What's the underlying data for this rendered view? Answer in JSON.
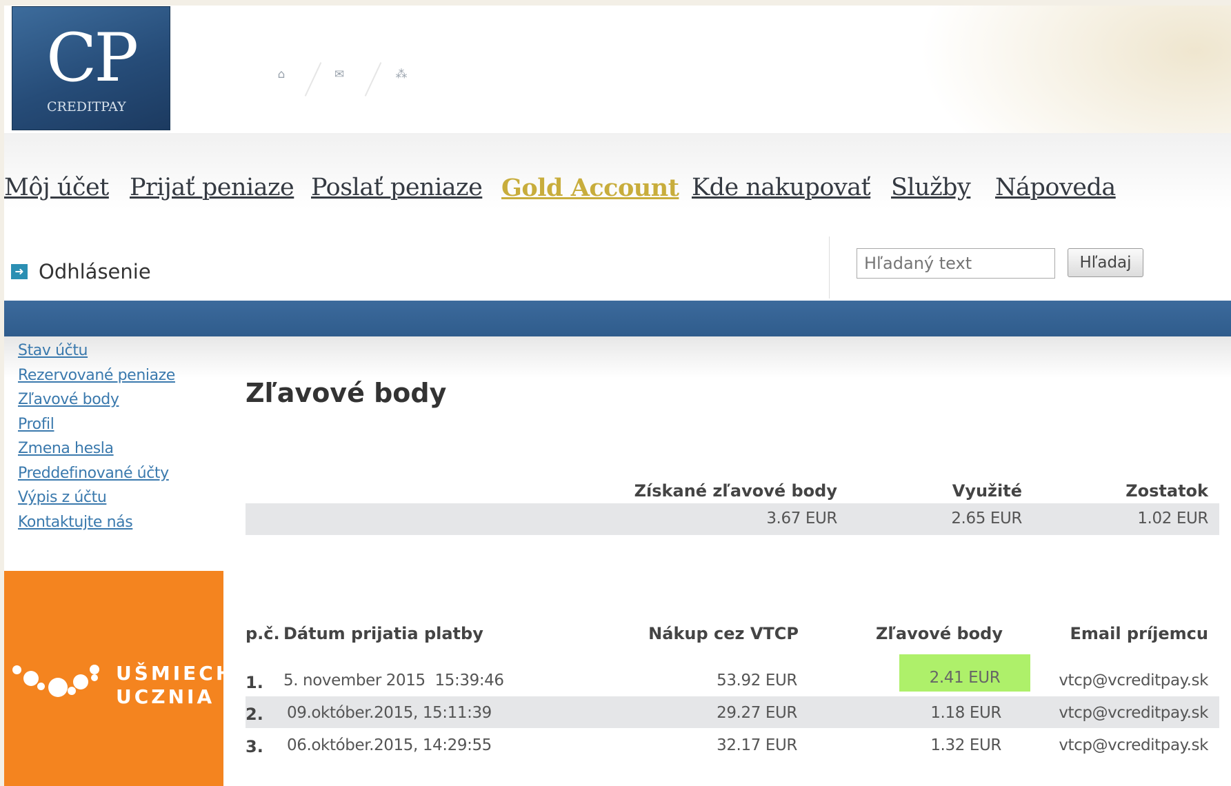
{
  "logo": {
    "monogram": "CP",
    "name": "CREDITPAY"
  },
  "top_icons": [
    "home-icon",
    "mail-icon",
    "sitemap-icon"
  ],
  "main_nav": [
    {
      "label": "Môj účet"
    },
    {
      "label": "Prijať peniaze"
    },
    {
      "label": "Poslať peniaze"
    },
    {
      "label": "Gold Account",
      "highlight": true
    },
    {
      "label": "Kde nakupovať"
    },
    {
      "label": "Služby"
    },
    {
      "label": "Nápoveda"
    }
  ],
  "logout_label": "Odhlásenie",
  "search": {
    "placeholder": "Hľadaný text",
    "button": "Hľadaj"
  },
  "side_nav": [
    "Stav účtu",
    "Rezervované peniaze",
    "Zľavové body",
    "Profil",
    "Zmena hesla",
    "Preddefinované účty",
    "Výpis z účtu",
    "Kontaktujte nás"
  ],
  "banner": {
    "line1": "UŠMIECH",
    "line2": "UCZNIA"
  },
  "page_title": "Zľavové body",
  "summary": {
    "headers": [
      "Získané zľavové body",
      "Využité",
      "Zostatok"
    ],
    "values": [
      "3.67 EUR",
      "2.65 EUR",
      "1.02 EUR"
    ]
  },
  "transactions": {
    "headers": {
      "no": "p.č.",
      "date": "Dátum prijatia platby",
      "purchase": "Nákup cez VTCP",
      "points": "Zľavové body",
      "email": "Email príjemcu"
    },
    "rows": [
      {
        "no": "1.",
        "date": "5. november 2015  15:39:46",
        "purchase": "53.92 EUR",
        "points": "2.41 EUR",
        "email": "vtcp@vcreditpay.sk"
      },
      {
        "no": "2.",
        "date": "09.október.2015, 15:11:39",
        "purchase": "29.27 EUR",
        "points": "1.18 EUR",
        "email": "vtcp@vcreditpay.sk"
      },
      {
        "no": "3.",
        "date": "06.október.2015, 14:29:55",
        "purchase": "32.17 EUR",
        "points": "1.32 EUR",
        "email": "vtcp@vcreditpay.sk"
      }
    ]
  },
  "colors": {
    "highlight": "#aef06a",
    "brand_blue": "#2f5c8c",
    "gold": "#c8ad3c",
    "banner_orange": "#f4841f"
  }
}
